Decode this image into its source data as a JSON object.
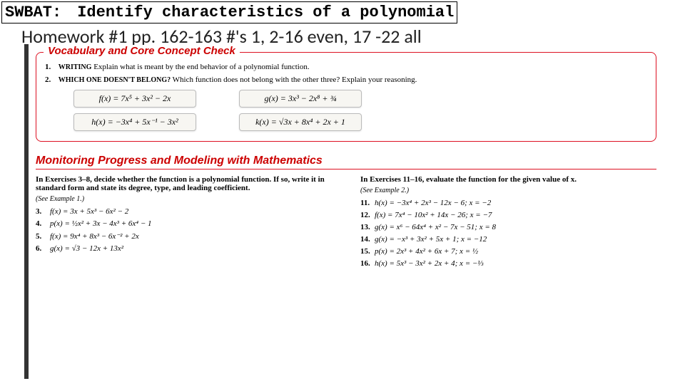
{
  "swbat_label": "SWBAT:",
  "swbat_text": "Identify characteristics of a polynomial",
  "hw_title": "Homework #1 pp. 162-163  #'s 1, 2-16 even, 17 -22 all",
  "vocab": {
    "title": "Vocabulary and Core Concept Check",
    "q1": {
      "num": "1.",
      "tag": "WRITING",
      "text": "Explain what is meant by the end behavior of a polynomial function."
    },
    "q2": {
      "num": "2.",
      "tag": "WHICH ONE DOESN'T BELONG?",
      "text": "Which function does not belong with the other three? Explain your reasoning."
    },
    "eq_f": "f(x) = 7x⁵ + 3x² − 2x",
    "eq_g": "g(x) = 3x³ − 2x⁸ + ¾",
    "eq_h": "h(x) = −3x⁴ + 5x⁻¹ − 3x²",
    "eq_k": "k(x) = √3x + 8x⁴ + 2x + 1"
  },
  "section2": "Monitoring Progress and Modeling with Mathematics",
  "left": {
    "head": "In Exercises 3–8, decide whether the function is a polynomial function. If so, write it in standard form and state its degree, type, and leading coefficient.",
    "sub": "(See Example 1.)",
    "e3": {
      "n": "3.",
      "t": "f(x) = 3x + 5x³ − 6x² − 2"
    },
    "e4": {
      "n": "4.",
      "t": "p(x) = ½x² + 3x − 4x³ + 6x⁴ − 1"
    },
    "e5": {
      "n": "5.",
      "t": "f(x) = 9x⁴ + 8x³ − 6x⁻² + 2x"
    },
    "e6": {
      "n": "6.",
      "t": "g(x) = √3 − 12x + 13x²"
    }
  },
  "right": {
    "head": "In Exercises 11–16, evaluate the function for the given value of x.",
    "sub": "(See Example 2.)",
    "e11": {
      "n": "11.",
      "t": "h(x) = −3x⁴ + 2x³ − 12x − 6; x = −2"
    },
    "e12": {
      "n": "12.",
      "t": "f(x) = 7x⁴ − 10x² + 14x − 26; x = −7"
    },
    "e13": {
      "n": "13.",
      "t": "g(x) = x⁶ − 64x⁴ + x² − 7x − 51; x = 8"
    },
    "e14": {
      "n": "14.",
      "t": "g(x) = −x³ + 3x² + 5x + 1; x = −12"
    },
    "e15": {
      "n": "15.",
      "t": "p(x) = 2x³ + 4x² + 6x + 7; x = ½"
    },
    "e16": {
      "n": "16.",
      "t": "h(x) = 5x³ − 3x² + 2x + 4; x = −⅓"
    }
  }
}
